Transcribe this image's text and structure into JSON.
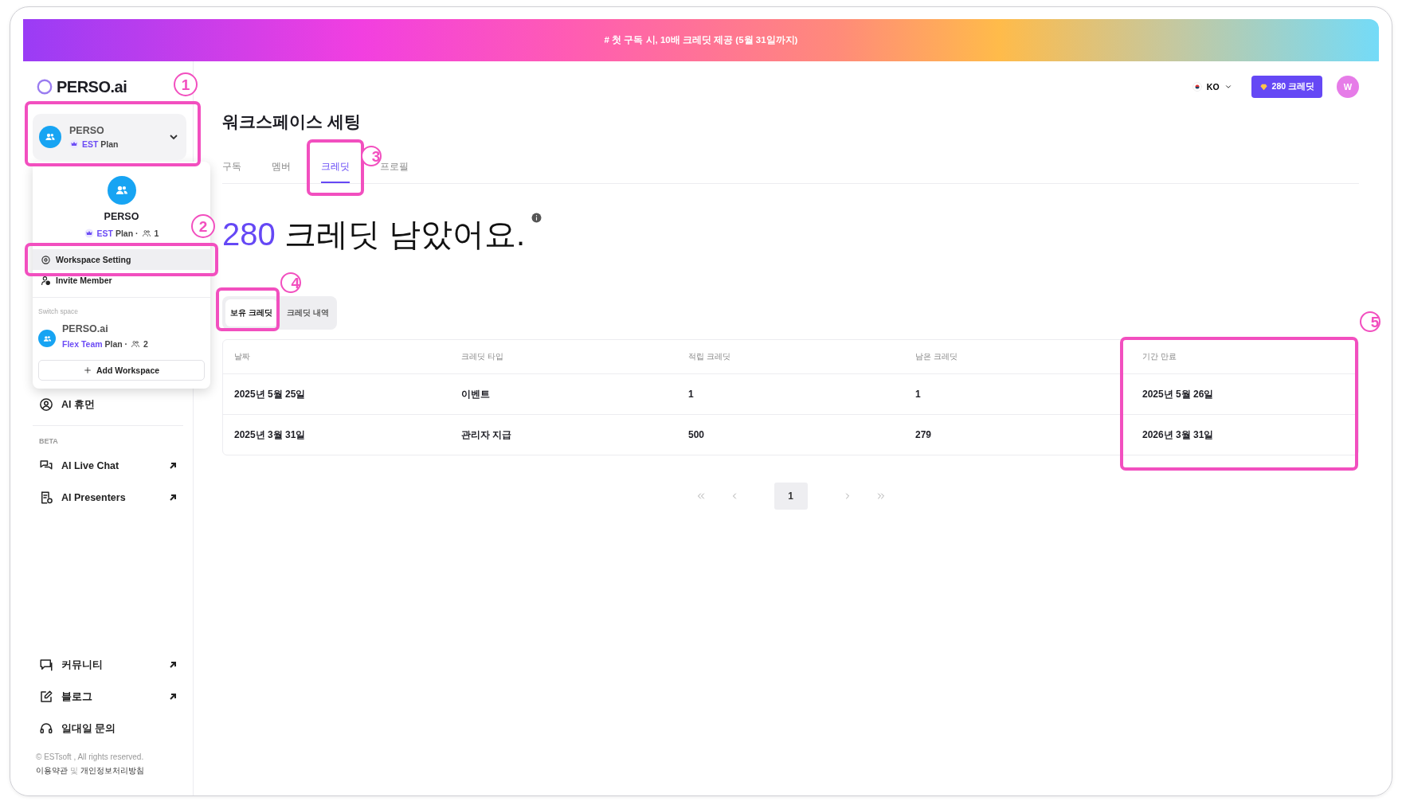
{
  "banner": {
    "text": "# 첫 구독 시, 10배 크레딧 제공 (5월 31일까지)"
  },
  "header": {
    "logo": "PERSO.ai",
    "language": "KO",
    "credits_button": "280 크레딧",
    "avatar": "W"
  },
  "sidebar": {
    "workspace": {
      "name": "PERSO",
      "plan_name": "EST",
      "plan": "Plan",
      "expanded": true,
      "callout": "1"
    },
    "dropdown": {
      "name": "PERSO",
      "plan_name": "EST",
      "plan": "Plan",
      "separator": "·",
      "members": "1",
      "actions": [
        {
          "label": "Workspace Setting",
          "kind": "settings",
          "selected": true,
          "callout": "2"
        },
        {
          "label": "Invite Member",
          "kind": "invite",
          "selected": false
        }
      ],
      "switch_label": "Switch space",
      "spaces": [
        {
          "name": "PERSO.ai",
          "plan_name": "Flex Team",
          "plan": "Plan",
          "separator": "·",
          "members": "2"
        }
      ],
      "add_button": "Add Workspace"
    },
    "items": [
      {
        "label": "AI 휴먼",
        "kind": "human",
        "external": false
      }
    ],
    "beta_label": "BETA",
    "beta_items": [
      {
        "label": "AI Live Chat",
        "kind": "chat",
        "external": true
      },
      {
        "label": "AI Presenters",
        "kind": "presenter",
        "external": true
      }
    ],
    "bottom_items": [
      {
        "label": "커뮤니티",
        "kind": "community",
        "external": true
      },
      {
        "label": "블로그",
        "kind": "blog",
        "external": true
      },
      {
        "label": "일대일 문의",
        "kind": "support",
        "external": false
      }
    ],
    "copyright": "© ESTsoft , All rights reserved.",
    "terms": "이용약관",
    "joiner": "및",
    "privacy": "개인정보처리방침"
  },
  "main": {
    "title": "워크스페이스 세팅",
    "tabs": [
      {
        "label": "구독",
        "selected": false
      },
      {
        "label": "멤버",
        "selected": false
      },
      {
        "label": "크레딧",
        "selected": true,
        "callout": "3"
      },
      {
        "label": "프로필",
        "selected": false
      }
    ],
    "credits": {
      "amount": "280",
      "text": "크레딧 남았어요."
    },
    "segments": [
      {
        "label": "보유 크레딧",
        "selected": true,
        "callout": "4"
      },
      {
        "label": "크레딧 내역",
        "selected": false
      }
    ],
    "table": {
      "columns": [
        {
          "label": "날짜"
        },
        {
          "label": "크레딧 타입"
        },
        {
          "label": "적립 크레딧"
        },
        {
          "label": "남은 크레딧"
        },
        {
          "label": "기간 만료",
          "callout": "5"
        }
      ],
      "rows": [
        [
          "2025년 5월 25일",
          "이벤트",
          "1",
          "1",
          "2025년 5월 26일"
        ],
        [
          "2025년 3월 31일",
          "관리자 지급",
          "500",
          "279",
          "2026년 3월 31일"
        ]
      ]
    },
    "pagination": {
      "pages": [
        {
          "label": "1",
          "selected": true
        }
      ]
    }
  }
}
